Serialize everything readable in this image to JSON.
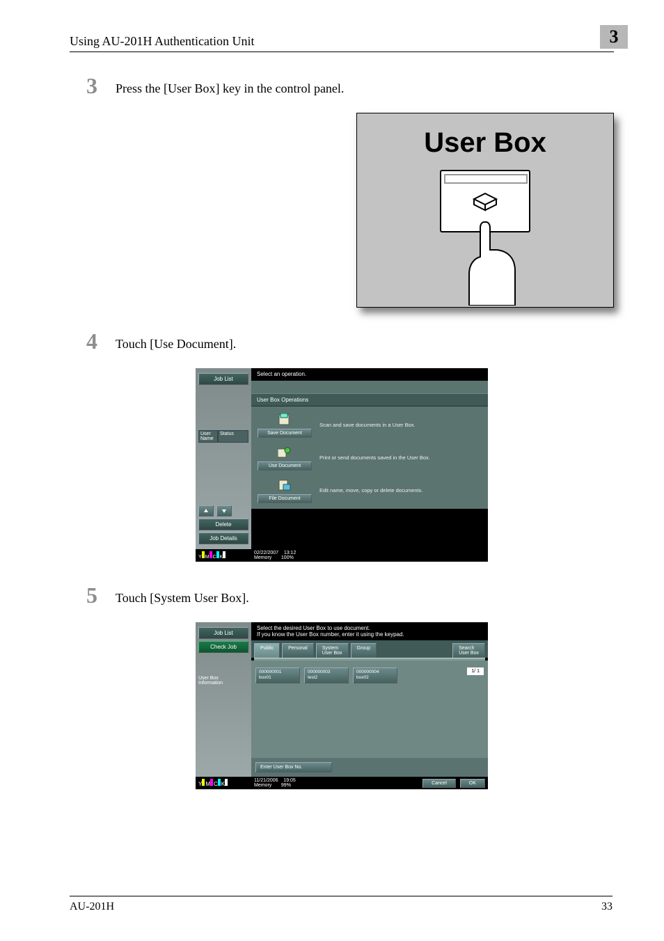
{
  "header": {
    "title": "Using AU-201H Authentication Unit",
    "chapter": "3"
  },
  "steps": {
    "s3": {
      "num": "3",
      "text": "Press the [User Box] key in the control panel."
    },
    "s4": {
      "num": "4",
      "text": "Touch [Use Document]."
    },
    "s5": {
      "num": "5",
      "text": "Touch [System User Box]."
    }
  },
  "fig1": {
    "title": "User Box"
  },
  "panel1": {
    "job_list": "Job List",
    "top_msg": "Select an operation.",
    "subheader": "User Box Operations",
    "side_userlabel": "User\nName",
    "side_status": "Status",
    "delete": "Delete",
    "job_details": "Job Details",
    "ops": {
      "save": {
        "btn": "Save Document",
        "text": "Scan and save documents in a User Box."
      },
      "use": {
        "btn": "Use Document",
        "text": "Print or send documents saved in the User Box."
      },
      "file": {
        "btn": "File Document",
        "text": "Edit name, move, copy or delete documents."
      }
    },
    "footer": {
      "date": "02/22/2007",
      "time": "13:12",
      "mem_label": "Memory",
      "mem_val": "100%"
    }
  },
  "panel2": {
    "job_list": "Job List",
    "check_job": "Check Job",
    "top_msg": "Select the desired User Box to use document.\nIf you know the User Box number, enter it using the keypad.",
    "side_info": "User Box\nInformation",
    "tabs": {
      "public": "Public",
      "personal": "Personal",
      "system": "System\nUser Box",
      "group": "Group",
      "search": "Search\nUser Box"
    },
    "boxes": [
      {
        "num": "000000001",
        "name": "box01"
      },
      {
        "num": "000000003",
        "name": "test2"
      },
      {
        "num": "000000004",
        "name": "box02"
      }
    ],
    "page_indicator": "1/  1",
    "enter_no": "Enter User Box No.",
    "footer": {
      "date": "11/21/2006",
      "time": "19:05",
      "mem_label": "Memory",
      "mem_val": "99%",
      "cancel": "Cancel",
      "ok": "OK"
    }
  },
  "page_footer": {
    "model": "AU-201H",
    "page": "33"
  },
  "ymck": {
    "y": "Y",
    "m": "M",
    "c": "C",
    "k": "K"
  }
}
